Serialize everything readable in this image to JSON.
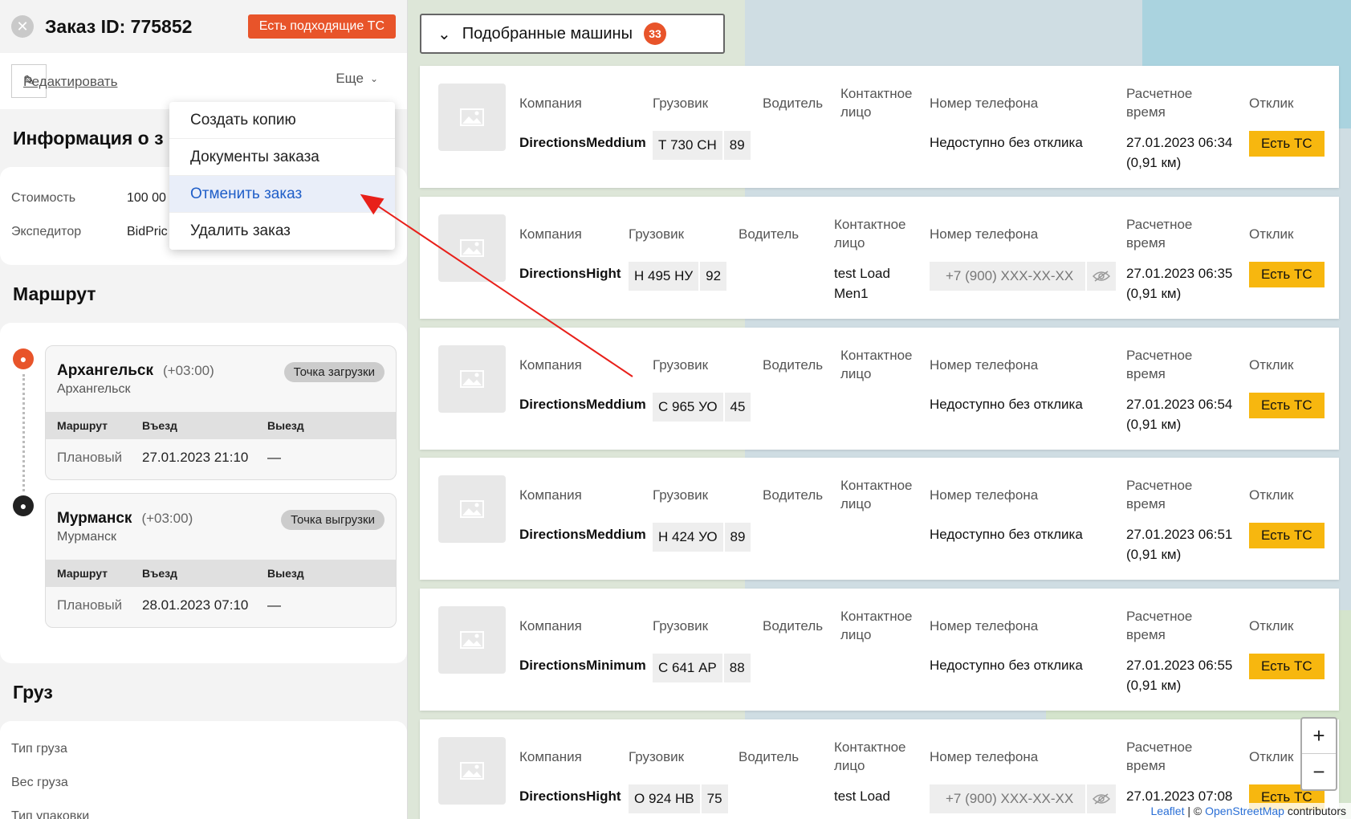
{
  "order": {
    "title": "Заказ ID: 775852",
    "badge": "Есть подходящие ТС",
    "edit_label": "Редактировать",
    "more_label": "Еще"
  },
  "dropdown": {
    "items": [
      "Создать копию",
      "Документы заказа",
      "Отменить заказ",
      "Удалить заказ"
    ]
  },
  "info": {
    "title": "Информация о з",
    "rows": [
      {
        "label": "Стоимость",
        "value": "100 00"
      },
      {
        "label": "Экспедитор",
        "value": "BidPric"
      }
    ]
  },
  "route": {
    "title": "Маршрут",
    "col_route": "Маршрут",
    "col_in": "Въезд",
    "col_out": "Выезд",
    "stops": [
      {
        "city": "Архангельск",
        "tz": "(+03:00)",
        "sub": "Архангельск",
        "badge": "Точка загрузки",
        "type": "Плановый",
        "in": "27.01.2023 21:10",
        "out": "—"
      },
      {
        "city": "Мурманск",
        "tz": "(+03:00)",
        "sub": "Мурманск",
        "badge": "Точка выгрузки",
        "type": "Плановый",
        "in": "28.01.2023 07:10",
        "out": "—"
      }
    ]
  },
  "cargo": {
    "title": "Груз",
    "rows": [
      "Тип груза",
      "Вес груза",
      "Тип упаковки"
    ]
  },
  "picked": {
    "label": "Подобранные машины",
    "count": "33"
  },
  "labels": {
    "company": "Компания",
    "truck": "Грузовик",
    "driver": "Водитель",
    "contact_1": "Контактное",
    "contact_2": "лицо",
    "phone": "Номер телефона",
    "time_1": "Расчетное",
    "time_2": "время",
    "response": "Отклик"
  },
  "vehicles": [
    {
      "company": "DirectionsMeddium",
      "plate": "Т 730 СН",
      "region": "89",
      "contact_1": "",
      "contact_2": "",
      "phone": "Недоступно без отклика",
      "masked": false,
      "time": "27.01.2023 06:34",
      "dist": "(0,91 км)",
      "response": "Есть ТС"
    },
    {
      "company": "DirectionsHight",
      "plate": "Н 495 НУ",
      "region": "92",
      "contact_1": "test Load",
      "contact_2": "Men1",
      "phone": "+7 (900) XXX-XX-XX",
      "masked": true,
      "time": "27.01.2023 06:35",
      "dist": "(0,91 км)",
      "response": "Есть ТС"
    },
    {
      "company": "DirectionsMeddium",
      "plate": "С 965 УО",
      "region": "45",
      "contact_1": "",
      "contact_2": "",
      "phone": "Недоступно без отклика",
      "masked": false,
      "time": "27.01.2023 06:54",
      "dist": "(0,91 км)",
      "response": "Есть ТС"
    },
    {
      "company": "DirectionsMeddium",
      "plate": "Н 424 УО",
      "region": "89",
      "contact_1": "",
      "contact_2": "",
      "phone": "Недоступно без отклика",
      "masked": false,
      "time": "27.01.2023 06:51",
      "dist": "(0,91 км)",
      "response": "Есть ТС"
    },
    {
      "company": "DirectionsMinimum",
      "plate": "С 641 АР",
      "region": "88",
      "contact_1": "",
      "contact_2": "",
      "phone": "Недоступно без отклика",
      "masked": false,
      "time": "27.01.2023 06:55",
      "dist": "(0,91 км)",
      "response": "Есть ТС"
    },
    {
      "company": "DirectionsHight",
      "plate": "О 924 НВ",
      "region": "75",
      "contact_1": "test Load",
      "contact_2": "",
      "phone": "+7 (900) XXX-XX-XX",
      "masked": true,
      "time": "27.01.2023 07:08",
      "dist": "",
      "response": "Есть ТС"
    }
  ],
  "map": {
    "zoom_in": "+",
    "zoom_out": "−",
    "attrib_leaflet": "Leaflet",
    "attrib_sep": " | © ",
    "attrib_osm": "OpenStreetMap",
    "attrib_contrib": " contributors"
  },
  "colors": {
    "accent_red": "#e8542a",
    "accent_yellow": "#f7b70f",
    "highlight_blue": "#1f5ec8",
    "annotation_arrow": "#e8201a"
  }
}
